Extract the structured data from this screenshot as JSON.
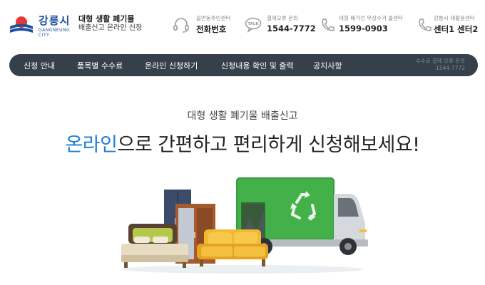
{
  "brand": {
    "name": "강릉시",
    "name_en": "GANGNEUNG CITY",
    "service_line1": "대형 생활 폐기물",
    "service_line2": "배출신고 온라인 신청"
  },
  "contacts": [
    {
      "label": "읍면동주민센터",
      "value": "전화번호",
      "icon": "headset-icon"
    },
    {
      "label": "결제오류 문의",
      "value": "1544-7772",
      "icon": "talk-bubble-icon"
    },
    {
      "label": "대형 폐가전 무상수거 콜센터",
      "value": "1599-0903",
      "icon": "phone-icon"
    },
    {
      "label": "강릉시 재활용센터",
      "value": "센터1  센터2",
      "icon": "phone-icon"
    }
  ],
  "nav": {
    "items": [
      "신청 안내",
      "품목별 수수료",
      "온라인 신청하기",
      "신청내용 확인 및 출력",
      "공지사항"
    ],
    "fee_label": "수수료 결제 오류 문의",
    "fee_number": "1544-7772"
  },
  "hero": {
    "subtitle": "대형 생활 폐기물 배출신고",
    "title_highlight": "온라인",
    "title_rest": "으로 간편하고 편리하게 신청해보세요!"
  },
  "colors": {
    "brand_blue": "#1f4fa0",
    "accent_blue": "#1f7fd0",
    "nav_bg": "#35404b",
    "truck_green": "#3fae45",
    "logo_red": "#e53935"
  }
}
